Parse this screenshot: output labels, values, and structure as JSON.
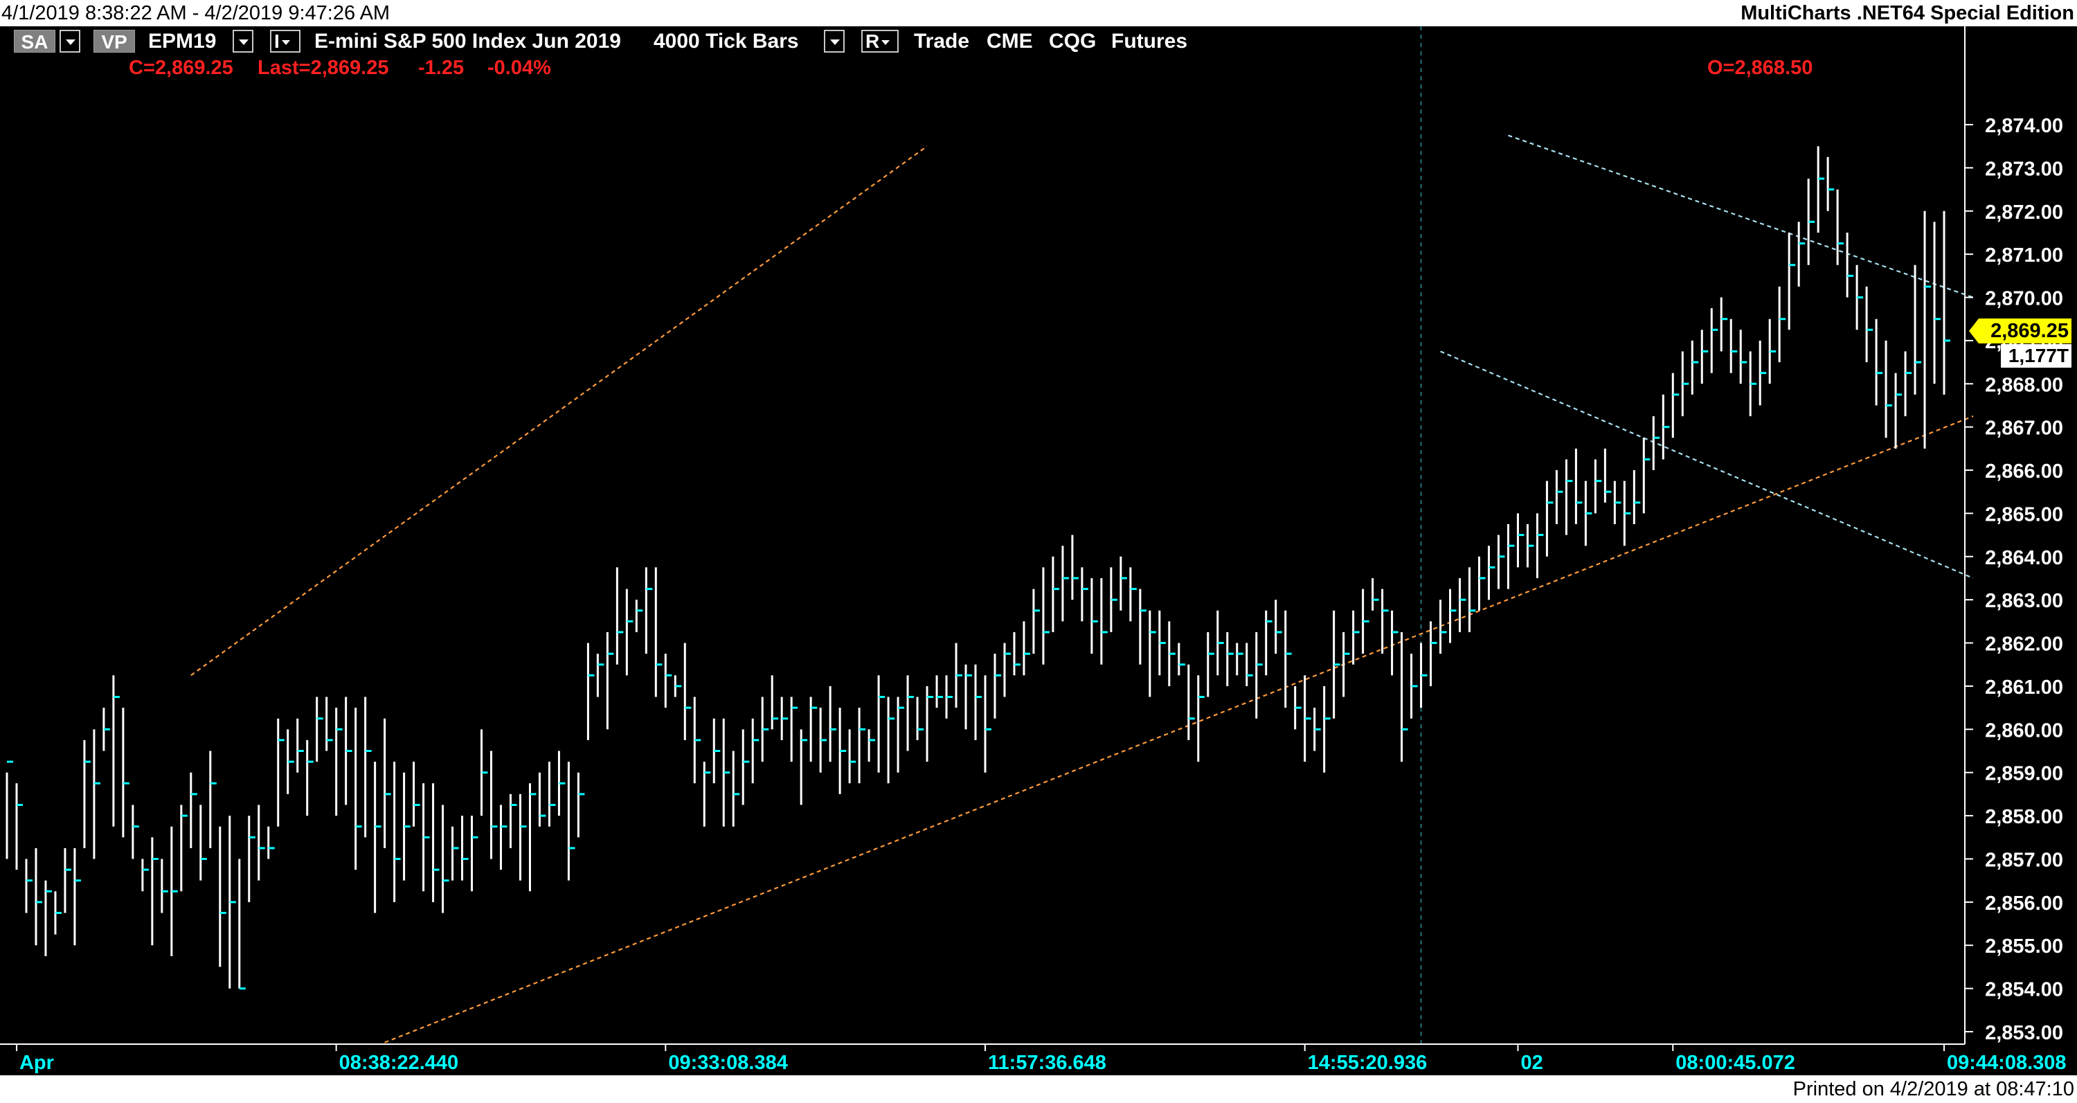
{
  "window": {
    "date_range": "4/1/2019 8:38:22 AM - 4/2/2019 9:47:26 AM",
    "edition": "MultiCharts .NET64 Special Edition",
    "printed_on": "Printed on 4/2/2019 at 08:47:10"
  },
  "toolbar": {
    "sa_label": "SA",
    "vp_label": "VP",
    "symbol": "EPM19",
    "i_label": "I",
    "description": "E-mini S&P 500 Index Jun 2019",
    "bar_type": "4000 Tick Bars",
    "r_label": "R",
    "mode": "Trade",
    "exchange": "CME",
    "feed": "CQG",
    "category": "Futures"
  },
  "quote": {
    "close": "C=2,869.25",
    "last": "Last=2,869.25",
    "change": "-1.25",
    "change_pct": "-0.04%",
    "open": "O=2,868.50"
  },
  "price_tag": "2,869.25",
  "volume_tag": "1,177T",
  "colors": {
    "background": "#000000",
    "bar": "#ffffff",
    "bar_close": "#00ffff",
    "axis_text": "#00ffff",
    "price_text": "#ffffff",
    "quote_text": "#ff2020",
    "channel_upper": "#ff9a3c",
    "channel_lower": "#a8e0f0",
    "price_tag_bg": "#ffff00"
  },
  "chart_data": {
    "type": "ohlc",
    "y_axis": {
      "range": [
        2852.75,
        2874.6
      ],
      "ticks": [
        "2,874.00",
        "2,873.00",
        "2,872.00",
        "2,871.00",
        "2,870.00",
        "2,869.00",
        "2,868.00",
        "2,867.00",
        "2,866.00",
        "2,865.00",
        "2,864.00",
        "2,863.00",
        "2,862.00",
        "2,861.00",
        "2,860.00",
        "2,859.00",
        "2,858.00",
        "2,857.00",
        "2,856.00",
        "2,855.00",
        "2,854.00",
        "2,853.00"
      ]
    },
    "x_axis": {
      "labels": [
        "Apr",
        "08:38:22.440",
        "09:33:08.384",
        "11:57:36.648",
        "14:55:20.936",
        "02",
        "08:00:45.072",
        "09:44:08.308"
      ],
      "label_bar_index": [
        1,
        34,
        68,
        101,
        134,
        156,
        172,
        200
      ]
    },
    "bar_count": 203,
    "session_break_bar": 146,
    "bars": [
      [
        2859.0,
        2857.0,
        2859.25
      ],
      [
        2858.75,
        2856.75,
        2858.25
      ],
      [
        2857.0,
        2855.75,
        2856.5
      ],
      [
        2857.25,
        2855.0,
        2856.0
      ],
      [
        2856.5,
        2854.75,
        2856.25
      ],
      [
        2856.25,
        2855.25,
        2855.75
      ],
      [
        2857.25,
        2855.75,
        2856.75
      ],
      [
        2857.25,
        2855.0,
        2856.5
      ],
      [
        2859.75,
        2857.25,
        2859.25
      ],
      [
        2860.0,
        2857.0,
        2858.75
      ],
      [
        2860.5,
        2859.5,
        2860.0
      ],
      [
        2861.25,
        2857.75,
        2860.75
      ],
      [
        2860.5,
        2857.5,
        2858.75
      ],
      [
        2858.25,
        2857.0,
        2857.75
      ],
      [
        2857.0,
        2856.25,
        2856.75
      ],
      [
        2857.5,
        2855.0,
        2857.0
      ],
      [
        2857.0,
        2855.75,
        2856.25
      ],
      [
        2857.75,
        2854.75,
        2856.25
      ],
      [
        2858.25,
        2856.25,
        2858.0
      ],
      [
        2859.0,
        2857.25,
        2858.5
      ],
      [
        2858.25,
        2856.5,
        2857.0
      ],
      [
        2859.5,
        2857.25,
        2858.75
      ],
      [
        2857.75,
        2854.5,
        2855.75
      ],
      [
        2858.0,
        2854.0,
        2856.0
      ],
      [
        2857.0,
        2854.0,
        2854.0
      ],
      [
        2858.0,
        2856.0,
        2857.5
      ],
      [
        2858.25,
        2856.5,
        2857.25
      ],
      [
        2857.75,
        2857.0,
        2857.25
      ],
      [
        2860.25,
        2857.75,
        2859.75
      ],
      [
        2860.0,
        2858.5,
        2859.25
      ],
      [
        2860.25,
        2859.0,
        2859.5
      ],
      [
        2859.75,
        2858.0,
        2859.25
      ],
      [
        2860.75,
        2859.25,
        2860.25
      ],
      [
        2860.75,
        2859.5,
        2859.75
      ],
      [
        2860.5,
        2858.0,
        2860.0
      ],
      [
        2860.75,
        2858.25,
        2859.5
      ],
      [
        2860.5,
        2856.75,
        2857.75
      ],
      [
        2860.75,
        2857.5,
        2859.5
      ],
      [
        2859.25,
        2855.75,
        2857.75
      ],
      [
        2860.25,
        2857.25,
        2858.5
      ],
      [
        2859.25,
        2856.0,
        2857.0
      ],
      [
        2859.0,
        2856.5,
        2857.75
      ],
      [
        2859.25,
        2857.75,
        2858.25
      ],
      [
        2858.75,
        2856.25,
        2857.5
      ],
      [
        2858.75,
        2856.0,
        2856.75
      ],
      [
        2858.25,
        2855.75,
        2856.5
      ],
      [
        2857.75,
        2856.5,
        2857.25
      ],
      [
        2858.0,
        2856.5,
        2857.0
      ],
      [
        2858.0,
        2856.25,
        2857.5
      ],
      [
        2860.0,
        2858.0,
        2859.0
      ],
      [
        2859.5,
        2857.0,
        2857.75
      ],
      [
        2858.25,
        2856.75,
        2857.75
      ],
      [
        2858.5,
        2857.25,
        2858.25
      ],
      [
        2858.5,
        2856.5,
        2857.75
      ],
      [
        2858.75,
        2856.25,
        2858.5
      ],
      [
        2859.0,
        2857.75,
        2858.0
      ],
      [
        2859.25,
        2857.75,
        2858.25
      ],
      [
        2859.5,
        2858.0,
        2858.75
      ],
      [
        2859.25,
        2856.5,
        2857.25
      ],
      [
        2859.0,
        2857.5,
        2858.5
      ],
      [
        2862.0,
        2859.75,
        2861.25
      ],
      [
        2861.75,
        2860.75,
        2861.5
      ],
      [
        2862.25,
        2860.0,
        2861.75
      ],
      [
        2863.75,
        2861.5,
        2862.25
      ],
      [
        2863.25,
        2861.25,
        2862.5
      ],
      [
        2863.0,
        2862.25,
        2862.75
      ],
      [
        2863.75,
        2861.75,
        2863.25
      ],
      [
        2863.75,
        2860.75,
        2861.5
      ],
      [
        2861.75,
        2860.5,
        2861.25
      ],
      [
        2861.25,
        2860.75,
        2861.0
      ],
      [
        2862.0,
        2859.75,
        2860.5
      ],
      [
        2860.75,
        2858.75,
        2859.75
      ],
      [
        2859.25,
        2857.75,
        2859.0
      ],
      [
        2860.25,
        2858.75,
        2859.5
      ],
      [
        2860.25,
        2857.75,
        2859.0
      ],
      [
        2859.5,
        2857.75,
        2858.5
      ],
      [
        2860.0,
        2858.25,
        2859.25
      ],
      [
        2860.25,
        2858.75,
        2859.75
      ],
      [
        2860.75,
        2859.25,
        2860.0
      ],
      [
        2861.25,
        2860.0,
        2860.25
      ],
      [
        2860.75,
        2859.75,
        2860.25
      ],
      [
        2860.75,
        2859.25,
        2860.5
      ],
      [
        2860.0,
        2858.25,
        2859.75
      ],
      [
        2860.75,
        2859.25,
        2860.5
      ],
      [
        2860.5,
        2859.0,
        2859.75
      ],
      [
        2861.0,
        2859.25,
        2860.0
      ],
      [
        2860.5,
        2858.5,
        2859.5
      ],
      [
        2860.0,
        2858.75,
        2859.25
      ],
      [
        2860.5,
        2858.75,
        2860.0
      ],
      [
        2860.0,
        2859.25,
        2859.75
      ],
      [
        2861.25,
        2859.0,
        2860.75
      ],
      [
        2860.75,
        2858.75,
        2860.25
      ],
      [
        2860.75,
        2859.0,
        2860.5
      ],
      [
        2861.25,
        2859.5,
        2860.75
      ],
      [
        2860.75,
        2859.75,
        2860.0
      ],
      [
        2861.0,
        2859.25,
        2860.75
      ],
      [
        2861.25,
        2860.5,
        2860.75
      ],
      [
        2861.25,
        2860.25,
        2860.75
      ],
      [
        2862.0,
        2860.5,
        2861.25
      ],
      [
        2861.5,
        2860.0,
        2861.25
      ],
      [
        2861.5,
        2859.75,
        2860.75
      ],
      [
        2861.25,
        2859.0,
        2860.0
      ],
      [
        2861.75,
        2860.25,
        2861.25
      ],
      [
        2862.0,
        2860.75,
        2861.75
      ],
      [
        2862.25,
        2861.25,
        2861.5
      ],
      [
        2862.5,
        2861.25,
        2861.75
      ],
      [
        2863.25,
        2861.75,
        2862.75
      ],
      [
        2863.75,
        2861.5,
        2862.25
      ],
      [
        2864.0,
        2862.25,
        2863.25
      ],
      [
        2864.25,
        2862.5,
        2863.5
      ],
      [
        2864.5,
        2863.0,
        2863.5
      ],
      [
        2863.75,
        2862.5,
        2863.25
      ],
      [
        2863.5,
        2861.75,
        2862.5
      ],
      [
        2863.5,
        2861.5,
        2862.25
      ],
      [
        2863.75,
        2862.25,
        2863.0
      ],
      [
        2864.0,
        2862.75,
        2863.5
      ],
      [
        2863.75,
        2862.5,
        2863.25
      ],
      [
        2863.25,
        2861.5,
        2862.75
      ],
      [
        2862.75,
        2860.75,
        2862.25
      ],
      [
        2862.75,
        2861.25,
        2862.0
      ],
      [
        2862.5,
        2861.0,
        2861.75
      ],
      [
        2862.0,
        2861.25,
        2861.5
      ],
      [
        2861.5,
        2859.75,
        2860.25
      ],
      [
        2861.25,
        2859.25,
        2860.75
      ],
      [
        2862.25,
        2860.75,
        2861.75
      ],
      [
        2862.75,
        2861.25,
        2862.0
      ],
      [
        2862.25,
        2861.0,
        2861.75
      ],
      [
        2862.0,
        2861.25,
        2861.75
      ],
      [
        2862.0,
        2861.0,
        2861.25
      ],
      [
        2862.25,
        2860.25,
        2861.5
      ],
      [
        2862.75,
        2861.25,
        2862.5
      ],
      [
        2863.0,
        2861.75,
        2862.25
      ],
      [
        2862.75,
        2860.5,
        2861.75
      ],
      [
        2861.0,
        2860.0,
        2860.5
      ],
      [
        2861.25,
        2859.25,
        2860.25
      ],
      [
        2860.5,
        2859.5,
        2860.0
      ],
      [
        2861.0,
        2859.0,
        2860.25
      ],
      [
        2862.75,
        2860.25,
        2861.5
      ],
      [
        2862.25,
        2860.75,
        2861.75
      ],
      [
        2862.75,
        2861.5,
        2862.25
      ],
      [
        2863.25,
        2861.75,
        2862.5
      ],
      [
        2863.5,
        2862.75,
        2863.0
      ],
      [
        2863.25,
        2861.75,
        2862.75
      ],
      [
        2862.75,
        2861.25,
        2862.25
      ],
      [
        2862.25,
        2859.25,
        2860.0
      ],
      [
        2861.75,
        2860.25,
        2861.0
      ],
      [
        2862.0,
        2860.5,
        2861.25
      ],
      [
        2862.5,
        2861.0,
        2862.0
      ],
      [
        2863.0,
        2861.75,
        2862.25
      ],
      [
        2863.25,
        2862.0,
        2862.75
      ],
      [
        2863.5,
        2862.25,
        2863.0
      ],
      [
        2863.75,
        2862.25,
        2862.75
      ],
      [
        2864.0,
        2862.75,
        2863.5
      ],
      [
        2864.25,
        2863.0,
        2863.75
      ],
      [
        2864.5,
        2863.25,
        2864.0
      ],
      [
        2864.75,
        2863.25,
        2864.25
      ],
      [
        2865.0,
        2863.75,
        2864.5
      ],
      [
        2864.75,
        2863.75,
        2864.25
      ],
      [
        2865.0,
        2863.5,
        2864.5
      ],
      [
        2865.75,
        2864.0,
        2865.25
      ],
      [
        2866.0,
        2864.75,
        2865.5
      ],
      [
        2866.25,
        2864.5,
        2865.75
      ],
      [
        2866.5,
        2864.75,
        2865.25
      ],
      [
        2865.75,
        2864.25,
        2865.0
      ],
      [
        2866.25,
        2865.0,
        2865.75
      ],
      [
        2866.5,
        2865.25,
        2865.5
      ],
      [
        2865.75,
        2864.75,
        2865.25
      ],
      [
        2865.75,
        2864.25,
        2865.0
      ],
      [
        2866.0,
        2864.75,
        2865.25
      ],
      [
        2866.75,
        2865.0,
        2866.25
      ],
      [
        2867.25,
        2866.0,
        2866.75
      ],
      [
        2867.75,
        2866.25,
        2867.0
      ],
      [
        2868.25,
        2866.75,
        2867.75
      ],
      [
        2868.75,
        2867.25,
        2868.0
      ],
      [
        2869.0,
        2867.75,
        2868.5
      ],
      [
        2869.25,
        2868.0,
        2868.75
      ],
      [
        2869.75,
        2868.25,
        2869.25
      ],
      [
        2870.0,
        2868.75,
        2869.5
      ],
      [
        2869.5,
        2868.25,
        2868.75
      ],
      [
        2869.25,
        2868.0,
        2868.5
      ],
      [
        2868.75,
        2867.25,
        2868.0
      ],
      [
        2869.0,
        2867.5,
        2868.25
      ],
      [
        2869.5,
        2868.0,
        2868.75
      ],
      [
        2870.25,
        2868.5,
        2869.5
      ],
      [
        2871.5,
        2869.25,
        2870.75
      ],
      [
        2871.75,
        2870.25,
        2871.25
      ],
      [
        2872.75,
        2870.75,
        2871.75
      ],
      [
        2873.5,
        2871.5,
        2872.75
      ],
      [
        2873.25,
        2872.0,
        2872.5
      ],
      [
        2872.5,
        2870.75,
        2871.25
      ],
      [
        2871.5,
        2870.0,
        2870.5
      ],
      [
        2870.75,
        2869.25,
        2870.0
      ],
      [
        2870.25,
        2868.5,
        2869.25
      ],
      [
        2869.5,
        2867.5,
        2868.25
      ],
      [
        2869.0,
        2866.75,
        2867.5
      ],
      [
        2868.25,
        2866.5,
        2867.75
      ],
      [
        2868.75,
        2867.25,
        2868.25
      ],
      [
        2870.75,
        2867.75,
        2868.5
      ],
      [
        2872.0,
        2866.5,
        2870.25
      ],
      [
        2871.75,
        2868.0,
        2869.5
      ],
      [
        2872.0,
        2867.75,
        2869.0
      ]
    ],
    "channels": [
      {
        "name": "",
        "points": [
          [
            19,
            2861.25
          ],
          [
            95,
            2873.5
          ]
        ]
      },
      {
        "name": "",
        "points": [
          [
            39,
            2852.75
          ],
          [
            203,
            2867.25
          ]
        ]
      },
      {
        "name": "",
        "points": [
          [
            148,
            2868.75
          ],
          [
            203,
            2863.5
          ]
        ]
      },
      {
        "name": "",
        "points": [
          [
            155,
            2873.75
          ],
          [
            203,
            2870.0
          ]
        ]
      }
    ]
  }
}
